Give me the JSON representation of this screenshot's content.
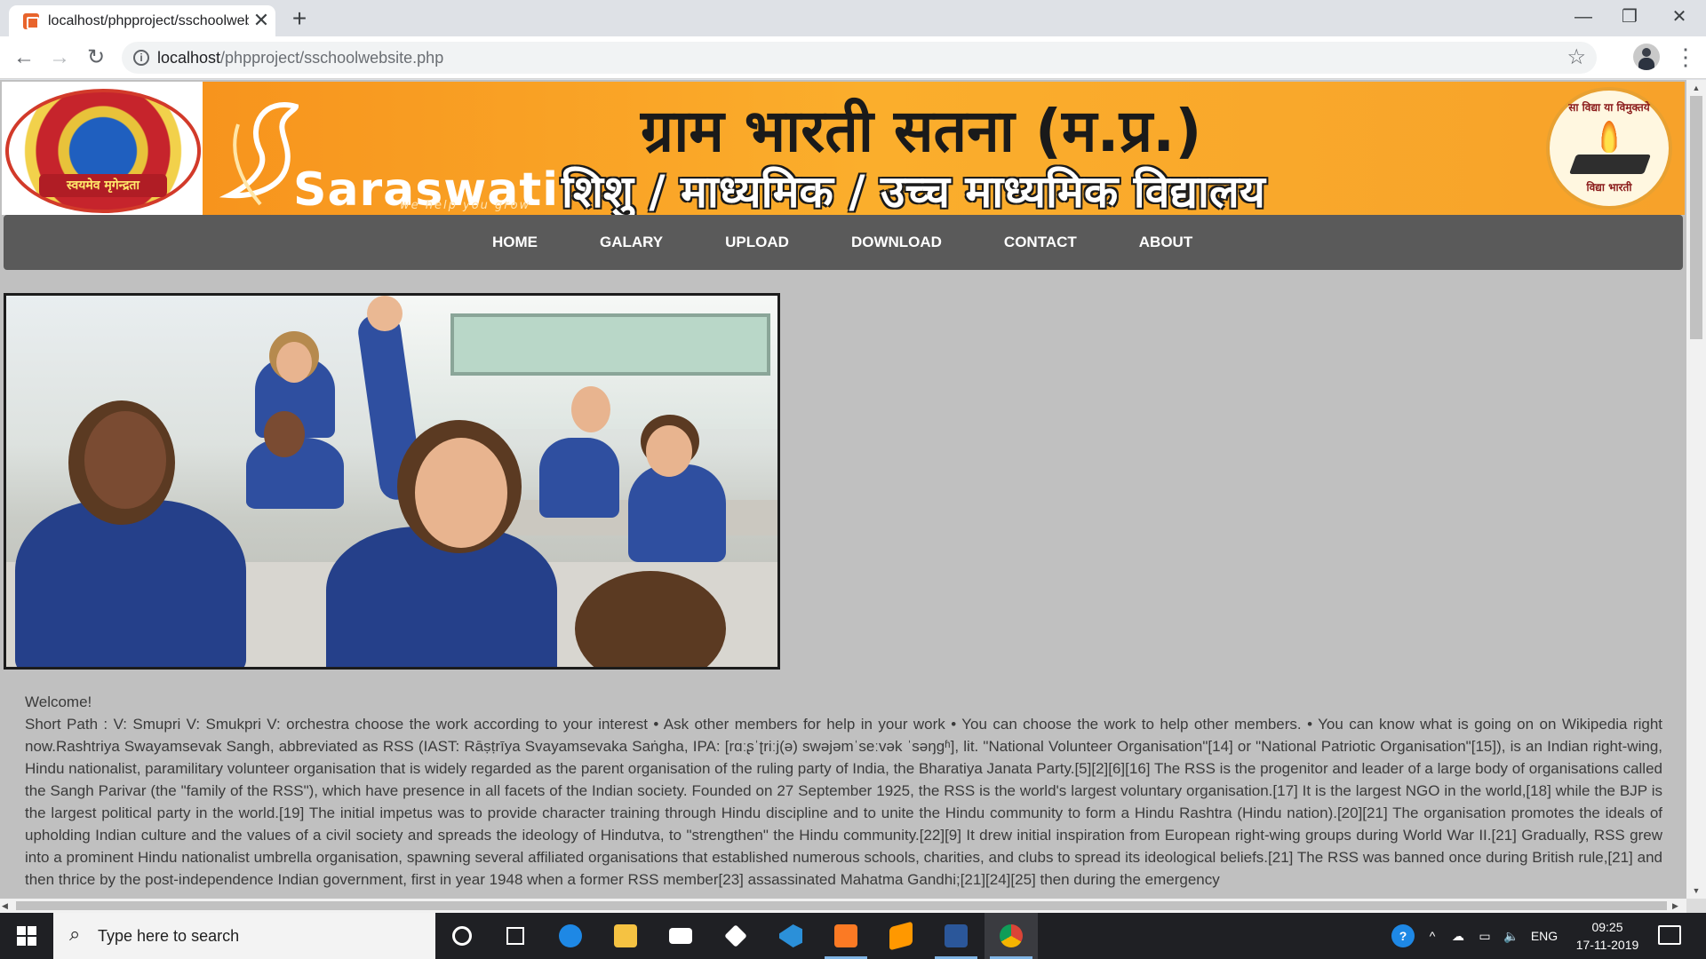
{
  "browser": {
    "tab_title": "localhost/phpproject/sschoolwebsite.php",
    "tab_close": "✕",
    "new_tab": "+",
    "url_host": "localhost",
    "url_path": "/phpproject/sschoolwebsite.php",
    "info": "i",
    "minimize": "—",
    "restore": "❐",
    "close": "✕",
    "back": "←",
    "forward": "→",
    "reload": "↻",
    "star": "☆",
    "menu": "⋮"
  },
  "site": {
    "logo_left_ribbon": "स्वयमेव मृगेन्द्रता",
    "brand_name": "Saraswati",
    "brand_tagline": "we help you grow",
    "title": "ग्राम भारती सतना (म.प्र.)",
    "subtitle": "शिशु / माध्यमिक / उच्च माध्यमिक विद्यालय",
    "logo_right_motto": "सा विद्या या विमुक्तये",
    "logo_right_bottom": "विद्या भारती",
    "nav": [
      "HOME",
      "GALARY",
      "UPLOAD",
      "DOWNLOAD",
      "CONTACT",
      "ABOUT"
    ]
  },
  "article": {
    "welcome": "Welcome!",
    "body": "Short Path : V: Smupri V: Smukpri V: orchestra choose the work according to your interest • Ask other members for help in your work • You can choose the work to help other members. • You can know what is going on on Wikipedia right now.Rashtriya Swayamsevak Sangh, abbreviated as RSS (IAST: Rāṣṭrīya Svayamsevaka Saṅgha, IPA: [rɑːʂˈʈriːj(ə) swəjəmˈseːvək ˈsəŋɡʱ], lit. \"National Volunteer Organisation\"[14] or \"National Patriotic Organisation\"[15]), is an Indian right-wing, Hindu nationalist, paramilitary volunteer organisation that is widely regarded as the parent organisation of the ruling party of India, the Bharatiya Janata Party.[5][2][6][16] The RSS is the progenitor and leader of a large body of organisations called the Sangh Parivar (the \"family of the RSS\"), which have presence in all facets of the Indian society. Founded on 27 September 1925, the RSS is the world's largest voluntary organisation.[17] It is the largest NGO in the world,[18] while the BJP is the largest political party in the world.[19] The initial impetus was to provide character training through Hindu discipline and to unite the Hindu community to form a Hindu Rashtra (Hindu nation).[20][21] The organisation promotes the ideals of upholding Indian culture and the values of a civil society and spreads the ideology of Hindutva, to \"strengthen\" the Hindu community.[22][9] It drew initial inspiration from European right-wing groups during World War II.[21] Gradually, RSS grew into a prominent Hindu nationalist umbrella organisation, spawning several affiliated organisations that established numerous schools, charities, and clubs to spread its ideological beliefs.[21] The RSS was banned once during British rule,[21] and then thrice by the post-independence Indian government, first in year 1948 when a former RSS member[23] assassinated Mahatma Gandhi;[21][24][25] then during the emergency"
  },
  "taskbar": {
    "search_placeholder": "Type here to search",
    "search_icon": "⌕",
    "help": "?",
    "chevron": "^",
    "language": "ENG",
    "time": "09:25",
    "date": "17-11-2019"
  },
  "colors": {
    "banner_orange": "#f7941d",
    "nav_bg": "#5a5a5a",
    "page_bg": "#c0c0c0"
  }
}
